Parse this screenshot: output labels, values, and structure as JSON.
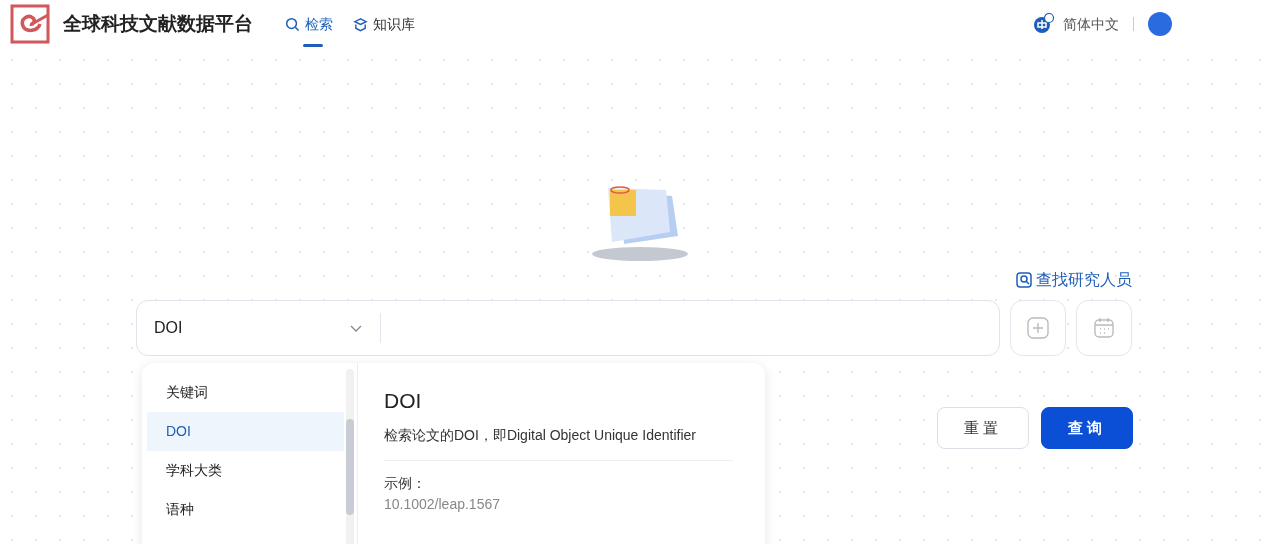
{
  "header": {
    "brand": "全球科技文献数据平台",
    "nav": [
      {
        "label": "检索",
        "selected": true
      },
      {
        "label": "知识库",
        "selected": false
      }
    ],
    "language": "简体中文"
  },
  "search": {
    "find_researcher": "查找研究人员",
    "field_select": {
      "value": "DOI"
    },
    "field_options": [
      {
        "label": "关键词",
        "selected": false
      },
      {
        "label": "DOI",
        "selected": true
      },
      {
        "label": "学科大类",
        "selected": false
      },
      {
        "label": "语种",
        "selected": false
      }
    ],
    "detail": {
      "title": "DOI",
      "description": "检索论文的DOI，即Digital Object Unique Identifier",
      "example_label": "示例：",
      "example": "10.1002/leap.1567"
    },
    "buttons": [
      {
        "label": "重置",
        "kind": "secondary"
      },
      {
        "label": "查询",
        "kind": "primary"
      }
    ]
  }
}
